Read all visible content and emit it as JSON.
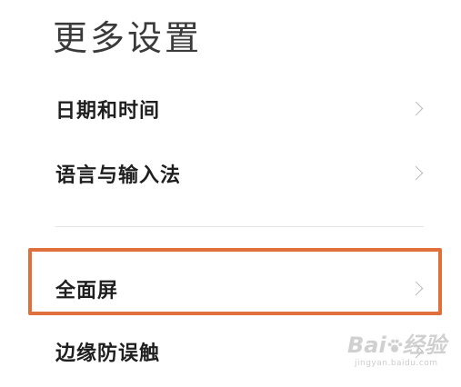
{
  "page": {
    "title": "更多设置"
  },
  "settings": {
    "items": [
      {
        "label": "日期和时间"
      },
      {
        "label": "语言与输入法"
      },
      {
        "label": "全面屏"
      },
      {
        "label": "边缘防误触"
      }
    ]
  },
  "colors": {
    "highlight": "#e0703b",
    "chevron": "#b8b8b8"
  },
  "watermark": {
    "brand": "Bai",
    "brand_suffix": "经验",
    "url": "jingyan.baidu.com"
  }
}
